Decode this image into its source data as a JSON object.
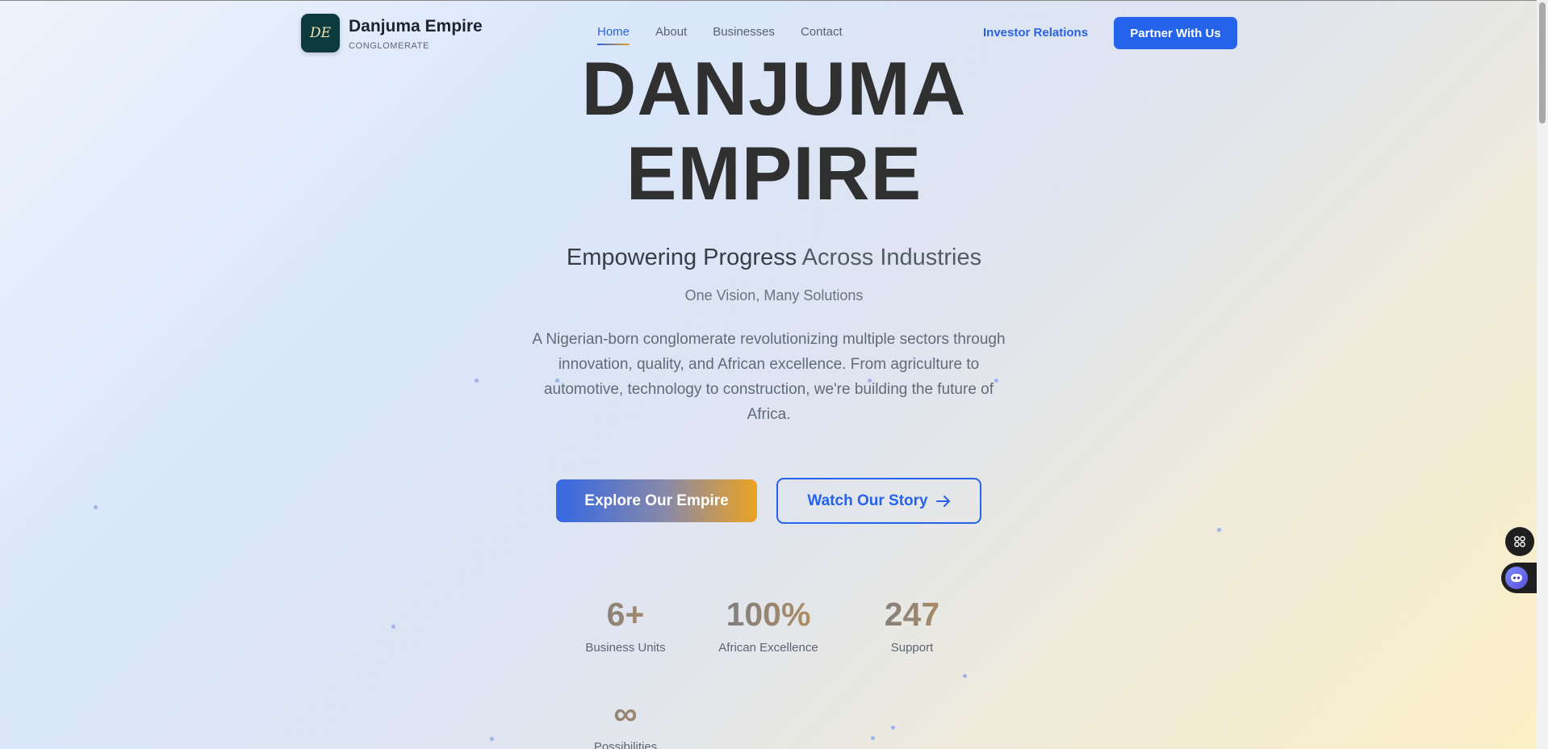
{
  "header": {
    "logo_monogram": "DE",
    "brand_name": "Danjuma Empire",
    "brand_sub": "CONGLOMERATE",
    "nav": [
      {
        "label": "Home",
        "active": true
      },
      {
        "label": "About",
        "active": false
      },
      {
        "label": "Businesses",
        "active": false
      },
      {
        "label": "Contact",
        "active": false
      }
    ],
    "investor_label": "Investor Relations",
    "partner_label": "Partner With Us"
  },
  "hero": {
    "title_line1": "DANJUMA",
    "title_line2": "EMPIRE",
    "tagline_bold": "Empowering Progress",
    "tagline_light": "Across Industries",
    "subtitle": "One Vision, Many Solutions",
    "description": "A Nigerian-born conglomerate revolutionizing multiple sectors through innovation, quality, and African excellence. From agriculture to automotive, technology to construction, we're building the future of Africa.",
    "explore_label": "Explore Our Empire",
    "story_label": "Watch Our Story"
  },
  "stats": [
    {
      "value": "6+",
      "label": "Business Units"
    },
    {
      "value": "100%",
      "label": "African Excellence"
    },
    {
      "value": "247",
      "label": "Support"
    },
    {
      "value": "∞",
      "label": "Possibilities"
    }
  ],
  "colors": {
    "accent": "#2563eb",
    "gold": "#e6a020",
    "logo_bg": "#0d3a3c"
  },
  "icons": {
    "story_arrow": "arrow-right-icon",
    "float_top": "command-icon",
    "float_bottom": "chatbot-icon"
  }
}
